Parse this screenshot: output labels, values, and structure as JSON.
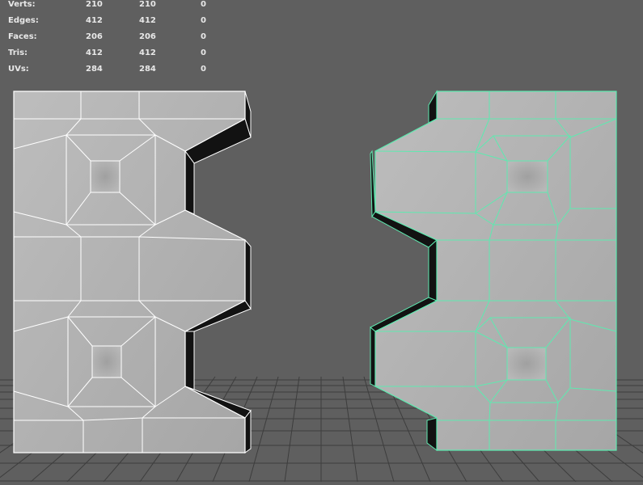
{
  "hud": {
    "rows": [
      {
        "label": "Verts:",
        "values": [
          "210",
          "210",
          "0"
        ]
      },
      {
        "label": "Edges:",
        "values": [
          "412",
          "412",
          "0"
        ]
      },
      {
        "label": "Faces:",
        "values": [
          "206",
          "206",
          "0"
        ]
      },
      {
        "label": "Tris:",
        "values": [
          "412",
          "412",
          "0"
        ]
      },
      {
        "label": "UVs:",
        "values": [
          "284",
          "284",
          "0"
        ]
      }
    ]
  },
  "colors": {
    "background": "#5f5f5f",
    "grid": "#3f3f3f",
    "mesh_face": "#b1b1b1",
    "wire_left": "#ffffff",
    "wire_right": "#5eeab0",
    "bevel_dark": "#101010",
    "hud_text": "#e8e8e8"
  },
  "icons": {
    "mesh_left": "mesh-object-icon",
    "mesh_right": "mesh-object-icon"
  }
}
